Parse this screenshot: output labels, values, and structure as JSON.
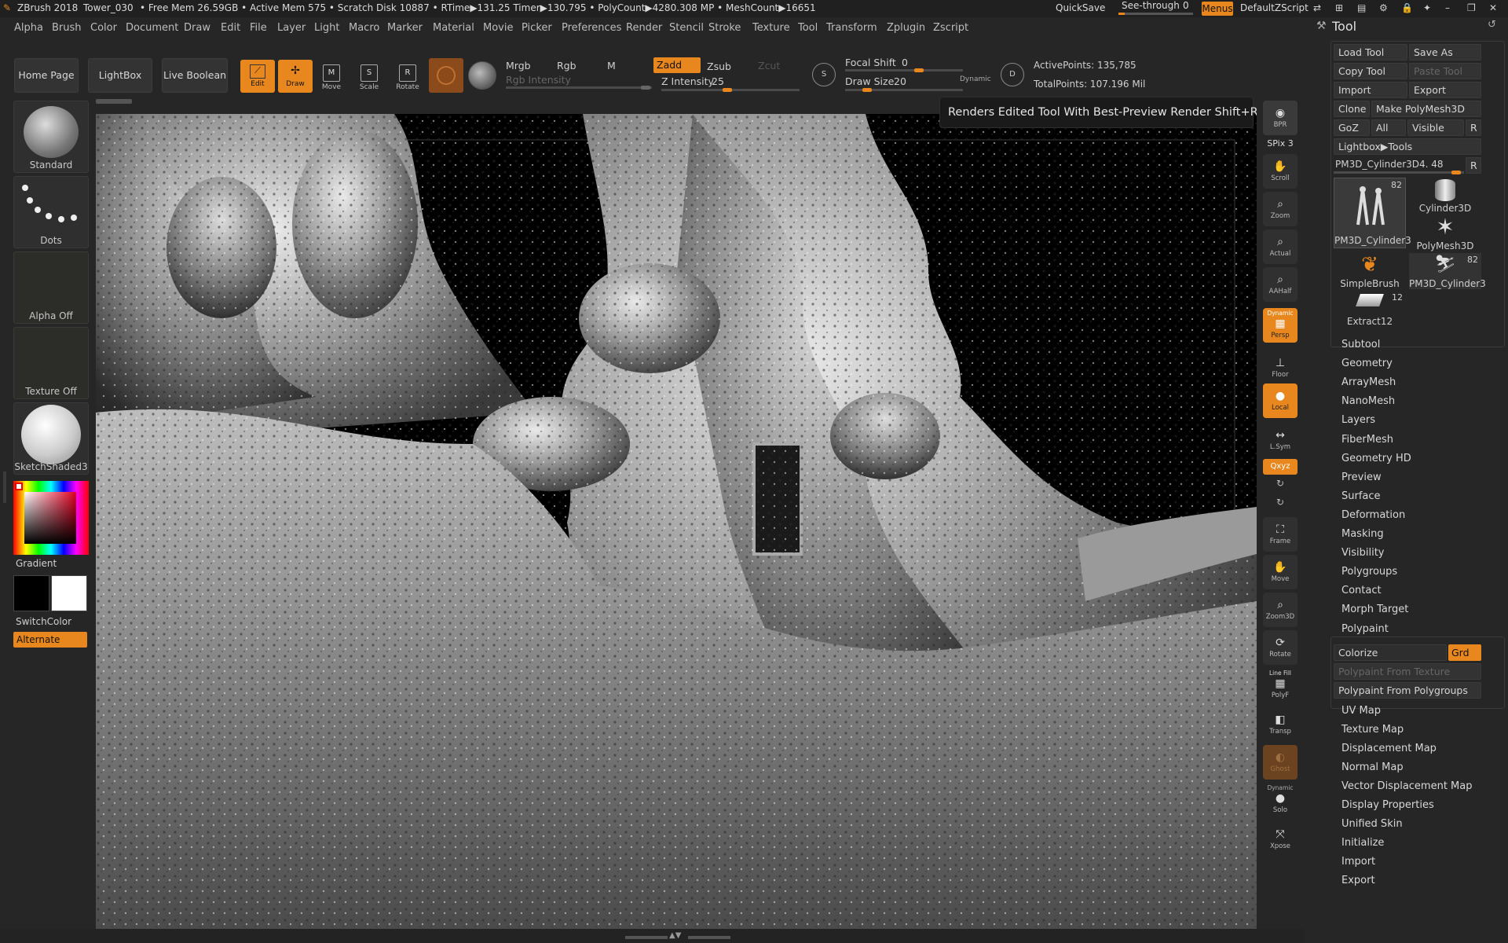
{
  "titlebar": {
    "app": "ZBrush 2018",
    "project": "Tower_030",
    "stats": "• Free Mem 26.59GB • Active Mem 575 • Scratch Disk 10887 • RTime▶131.25 Timer▶130.795 • PolyCount▶4280.308 MP • MeshCount▶16651",
    "quicksave": "QuickSave",
    "seethrough_label": "See-through",
    "seethrough_value": "0",
    "menus": "Menus",
    "default_zscript": "DefaultZScript"
  },
  "menubar": [
    "Alpha",
    "Brush",
    "Color",
    "Document",
    "Draw",
    "Edit",
    "File",
    "Layer",
    "Light",
    "Macro",
    "Marker",
    "Material",
    "Movie",
    "Picker",
    "Preferences",
    "Render",
    "Stencil",
    "Stroke",
    "Texture",
    "Tool",
    "Transform",
    "Zplugin",
    "Zscript"
  ],
  "shelf": {
    "home_page": "Home Page",
    "lightbox": "LightBox",
    "live_boolean": "Live Boolean",
    "edit": "Edit",
    "draw": "Draw",
    "move": "Move",
    "scale": "Scale",
    "rotate": "Rotate",
    "mrgb": "Mrgb",
    "rgb": "Rgb",
    "m": "M",
    "zadd": "Zadd",
    "zsub": "Zsub",
    "zcut": "Zcut",
    "rgb_intensity": "Rgb Intensity",
    "z_intensity_label": "Z Intensity",
    "z_intensity_value": "25",
    "focal_shift_label": "Focal Shift",
    "focal_shift_value": "0",
    "draw_size_label": "Draw Size",
    "draw_size_value": "20",
    "dynamic": "Dynamic",
    "active_points": "ActivePoints: 135,785",
    "total_points": "TotalPoints: 107.196 Mil"
  },
  "leftpanel": {
    "brush": "Standard",
    "stroke": "Dots",
    "alpha": "Alpha Off",
    "texture": "Texture Off",
    "material": "SketchShaded3",
    "gradient": "Gradient",
    "switchcolor": "SwitchColor",
    "alternate": "Alternate"
  },
  "tooltip": "Renders Edited Tool With Best-Preview Render  Shift+R",
  "righttoolbar": {
    "bpr": "BPR",
    "spix": "SPix 3",
    "scroll": "Scroll",
    "zoom": "Zoom",
    "actual": "Actual",
    "aahalf": "AAHalf",
    "persp_top": "Dynamic",
    "persp": "Persp",
    "floor": "Floor",
    "local": "Local",
    "lsym": "L.Sym",
    "xyz": "Qxyz",
    "frame": "Frame",
    "move": "Move",
    "zoom3d": "Zoom3D",
    "rotate": "Rotate",
    "linefill_top": "Line Fill",
    "polyf": "PolyF",
    "transp": "Transp",
    "ghost": "Ghost",
    "solo_top": "Dynamic",
    "solo": "Solo",
    "xpose": "Xpose"
  },
  "toolpalette": {
    "title": "Tool",
    "load_tool": "Load Tool",
    "save_as": "Save As",
    "copy_tool": "Copy Tool",
    "paste_tool": "Paste Tool",
    "import": "Import",
    "export": "Export",
    "clone": "Clone",
    "make_polymesh": "Make PolyMesh3D",
    "goz": "GoZ",
    "all": "All",
    "visible": "Visible",
    "r": "R",
    "lightbox_tools": "Lightbox▶Tools",
    "current_tool": "PM3D_Cylinder3D4. 48",
    "tools": [
      {
        "name": "PM3D_Cylinder3",
        "count": "82"
      },
      {
        "name": "Cylinder3D",
        "count": ""
      },
      {
        "name": "PolyMesh3D",
        "count": ""
      },
      {
        "name": "SimpleBrush",
        "count": ""
      },
      {
        "name": "PM3D_Cylinder3",
        "count": "82"
      },
      {
        "name": "Extract12",
        "count": "12"
      }
    ],
    "subpalettes_a": [
      "Subtool",
      "Geometry",
      "ArrayMesh",
      "NanoMesh",
      "Layers",
      "FiberMesh",
      "Geometry HD",
      "Preview",
      "Surface",
      "Deformation",
      "Masking",
      "Visibility",
      "Polygroups",
      "Contact",
      "Morph Target",
      "Polypaint"
    ],
    "colorize": "Colorize",
    "grd": "Grd",
    "polypaint_from_texture": "Polypaint From Texture",
    "polypaint_from_polygroups": "Polypaint From Polygroups",
    "subpalettes_b": [
      "UV Map",
      "Texture Map",
      "Displacement Map",
      "Normal Map",
      "Vector Displacement Map",
      "Display Properties",
      "Unified Skin",
      "Initialize",
      "Import",
      "Export"
    ]
  }
}
